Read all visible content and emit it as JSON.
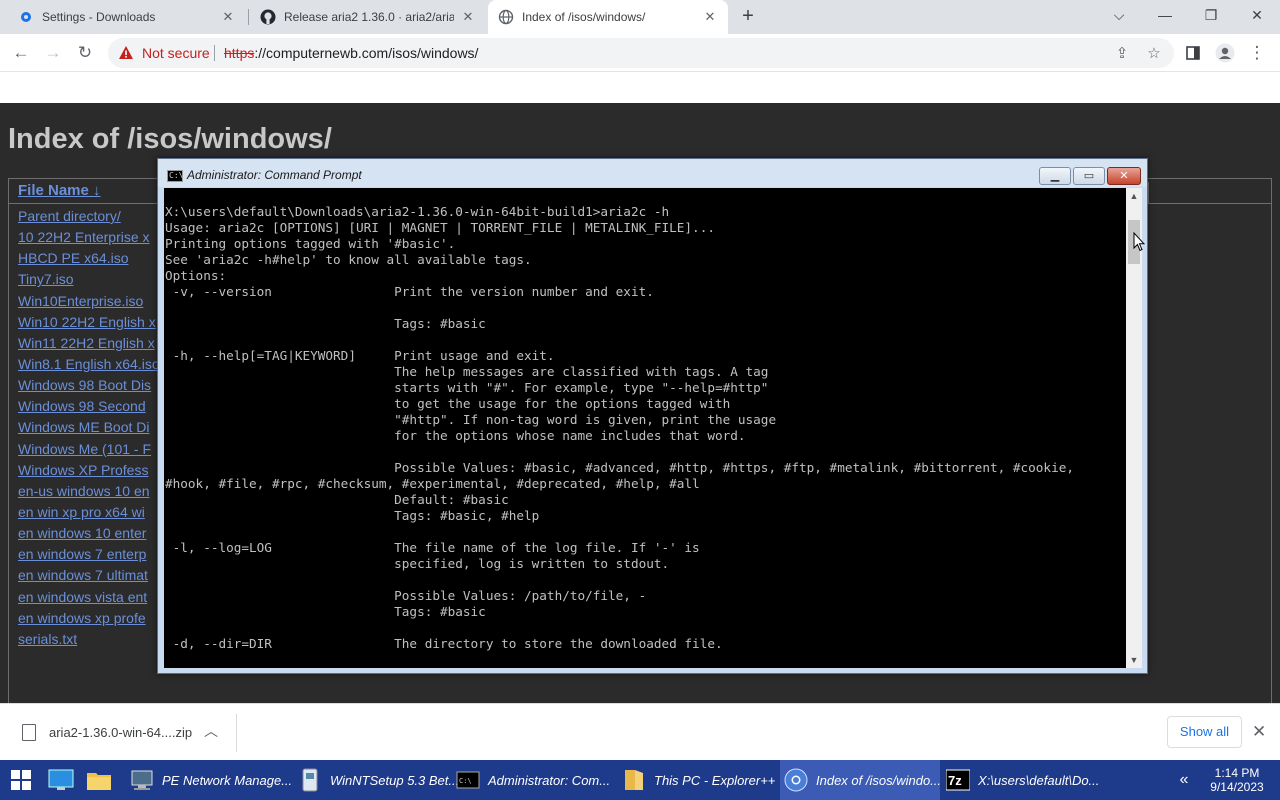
{
  "browser": {
    "tabs": [
      {
        "label": "Settings - Downloads",
        "icon": "gear-icon"
      },
      {
        "label": "Release aria2 1.36.0 · aria2/aria2 ·",
        "icon": "github-icon"
      },
      {
        "label": "Index of /isos/windows/",
        "icon": "globe-icon"
      }
    ],
    "address": {
      "security_label": "Not secure",
      "scheme": "https",
      "url_rest": "://computernewb.com/isos/windows/"
    }
  },
  "page": {
    "title": "Index of /isos/windows/",
    "column_header": "File Name  ↓",
    "files": [
      "Parent directory/",
      "10 22H2 Enterprise x",
      "HBCD PE x64.iso",
      "Tiny7.iso",
      "Win10Enterprise.iso",
      "Win10 22H2 English x",
      "Win11 22H2 English x",
      "Win8.1 English x64.iso",
      "Windows 98 Boot Dis",
      "Windows 98 Second",
      "Windows ME Boot Di",
      "Windows Me (101 - F",
      "Windows XP Profess",
      "en-us windows 10 en",
      "en win xp pro x64 wi",
      "en windows 10 enter",
      "en windows 7 enterp",
      "en windows 7 ultimat",
      "en windows vista ent",
      "en windows xp profe",
      "serials.txt"
    ]
  },
  "cmd": {
    "title": "Administrator: Command Prompt",
    "output": "X:\\users\\default\\Downloads\\aria2-1.36.0-win-64bit-build1>aria2c -h\nUsage: aria2c [OPTIONS] [URI | MAGNET | TORRENT_FILE | METALINK_FILE]...\nPrinting options tagged with '#basic'.\nSee 'aria2c -h#help' to know all available tags.\nOptions:\n -v, --version                Print the version number and exit.\n\n                              Tags: #basic\n\n -h, --help[=TAG|KEYWORD]     Print usage and exit.\n                              The help messages are classified with tags. A tag\n                              starts with \"#\". For example, type \"--help=#http\"\n                              to get the usage for the options tagged with\n                              \"#http\". If non-tag word is given, print the usage\n                              for the options whose name includes that word.\n\n                              Possible Values: #basic, #advanced, #http, #https, #ftp, #metalink, #bittorrent, #cookie,\n#hook, #file, #rpc, #checksum, #experimental, #deprecated, #help, #all\n                              Default: #basic\n                              Tags: #basic, #help\n\n -l, --log=LOG                The file name of the log file. If '-' is\n                              specified, log is written to stdout.\n\n                              Possible Values: /path/to/file, -\n                              Tags: #basic\n\n -d, --dir=DIR                The directory to store the downloaded file."
  },
  "downloads": {
    "file_name": "aria2-1.36.0-win-64....zip",
    "show_all": "Show all"
  },
  "taskbar": {
    "items": [
      {
        "label": "PE Network Manage...",
        "icon": "network-manager-icon"
      },
      {
        "label": "WinNTSetup 5.3 Bet...",
        "icon": "winntsetup-icon"
      },
      {
        "label": "Administrator: Com...",
        "icon": "cmd-icon"
      },
      {
        "label": "This PC - Explorer++",
        "icon": "folder-icon"
      },
      {
        "label": "Index of /isos/windo...",
        "icon": "chrome-icon"
      },
      {
        "label": "X:\\users\\default\\Do...",
        "icon": "7zip-icon"
      }
    ],
    "time": "1:14 PM",
    "date": "9/14/2023"
  },
  "colors": {
    "page_bg": "#2b2b2b",
    "link": "#6b8fd8",
    "taskbar": "#1e3a8a",
    "not_secure": "#c5221f"
  }
}
